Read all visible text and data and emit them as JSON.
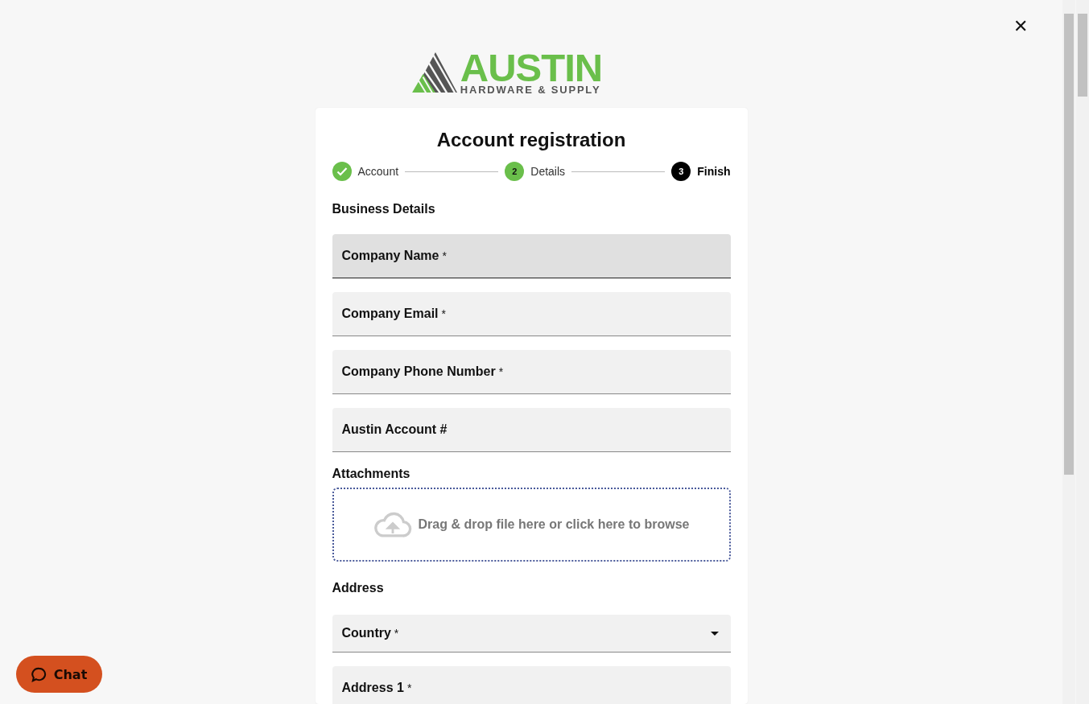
{
  "logo": {
    "name": "AUSTIN",
    "tagline": "HARDWARE & SUPPLY"
  },
  "close": {
    "glyph": "✕"
  },
  "title": "Account registration",
  "steps": [
    {
      "label": "Account",
      "kind": "done"
    },
    {
      "label": "Details",
      "kind": "visited",
      "number": "2"
    },
    {
      "label": "Finish",
      "kind": "current",
      "number": "3"
    }
  ],
  "sections": [
    {
      "heading": "Business Details",
      "items": [
        {
          "kind": "field",
          "label": "Company Name",
          "required_mark": "*",
          "focused": true
        },
        {
          "kind": "field",
          "label": "Company Email",
          "required_mark": "*",
          "focused": false
        },
        {
          "kind": "field",
          "label": "Company Phone Number",
          "required_mark": "*",
          "focused": false
        },
        {
          "kind": "field",
          "label": "Austin Account #",
          "focused": false
        }
      ]
    },
    {
      "heading": "Attachments",
      "items": [
        {
          "kind": "dropzone",
          "label": "Drag & drop file here or click here to browse"
        }
      ]
    },
    {
      "heading": "Address",
      "items": [
        {
          "kind": "select",
          "label": "Country",
          "required_mark": "*",
          "focused": false
        },
        {
          "kind": "field",
          "label": "Address 1",
          "required_mark": "*",
          "focused": false
        }
      ]
    }
  ],
  "chat": {
    "label": "Chat"
  }
}
